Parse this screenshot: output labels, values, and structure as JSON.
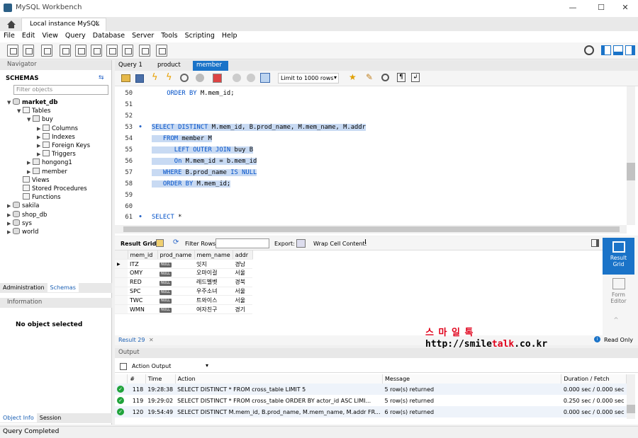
{
  "window": {
    "title": "MySQL Workbench",
    "connection_tab": "Local instance MySQL"
  },
  "menu": [
    "File",
    "Edit",
    "View",
    "Query",
    "Database",
    "Server",
    "Tools",
    "Scripting",
    "Help"
  ],
  "navigator": {
    "title": "Navigator",
    "schemas_label": "SCHEMAS",
    "filter_placeholder": "Filter objects",
    "tree": [
      {
        "label": "market_db",
        "level": 0,
        "open": true,
        "bold": true,
        "icon": "db"
      },
      {
        "label": "Tables",
        "level": 1,
        "open": true,
        "icon": "folder"
      },
      {
        "label": "buy",
        "level": 2,
        "open": true,
        "icon": "table"
      },
      {
        "label": "Columns",
        "level": 3,
        "open": false,
        "icon": "folder"
      },
      {
        "label": "Indexes",
        "level": 3,
        "open": false,
        "icon": "folder"
      },
      {
        "label": "Foreign Keys",
        "level": 3,
        "open": false,
        "icon": "folder"
      },
      {
        "label": "Triggers",
        "level": 3,
        "open": false,
        "icon": "folder"
      },
      {
        "label": "hongong1",
        "level": 2,
        "open": false,
        "icon": "table"
      },
      {
        "label": "member",
        "level": 2,
        "open": false,
        "icon": "table"
      },
      {
        "label": "Views",
        "level": 1,
        "icon": "folder"
      },
      {
        "label": "Stored Procedures",
        "level": 1,
        "icon": "folder"
      },
      {
        "label": "Functions",
        "level": 1,
        "icon": "folder"
      },
      {
        "label": "sakila",
        "level": 0,
        "open": false,
        "icon": "db"
      },
      {
        "label": "shop_db",
        "level": 0,
        "open": false,
        "icon": "db"
      },
      {
        "label": "sys",
        "level": 0,
        "open": false,
        "icon": "db"
      },
      {
        "label": "world",
        "level": 0,
        "open": false,
        "icon": "db"
      }
    ],
    "tabs": [
      "Administration",
      "Schemas"
    ],
    "info_title": "Information",
    "no_object": "No object selected",
    "bottom_tabs": [
      "Object Info",
      "Session"
    ]
  },
  "query_tabs": [
    "Query 1",
    "product",
    "member"
  ],
  "limit": "Limit to 1000 rows",
  "code_lines": [
    {
      "n": "50",
      "dot": false,
      "sel": false,
      "indent": "    ",
      "text": "ORDER BY M.mem_id;"
    },
    {
      "n": "51",
      "dot": false,
      "sel": false,
      "indent": "",
      "text": ""
    },
    {
      "n": "52",
      "dot": false,
      "sel": false,
      "indent": "",
      "text": ""
    },
    {
      "n": "53",
      "dot": true,
      "sel": true,
      "indent": "",
      "text": "SELECT DISTINCT M.mem_id, B.prod_name, M.mem_name, M.addr"
    },
    {
      "n": "54",
      "dot": false,
      "sel": true,
      "indent": "   ",
      "text": "FROM member M"
    },
    {
      "n": "55",
      "dot": false,
      "sel": true,
      "indent": "      ",
      "text": "LEFT OUTER JOIN buy B"
    },
    {
      "n": "56",
      "dot": false,
      "sel": true,
      "indent": "      ",
      "text": "On M.mem_id = b.mem_id"
    },
    {
      "n": "57",
      "dot": false,
      "sel": true,
      "indent": "   ",
      "text": "WHERE B.prod_name IS NULL"
    },
    {
      "n": "58",
      "dot": false,
      "sel": true,
      "indent": "   ",
      "text": "ORDER BY M.mem_id;"
    },
    {
      "n": "59",
      "dot": false,
      "sel": false,
      "indent": "",
      "text": ""
    },
    {
      "n": "60",
      "dot": false,
      "sel": false,
      "indent": "",
      "text": ""
    },
    {
      "n": "61",
      "dot": true,
      "sel": false,
      "indent": "",
      "text": "SELECT *"
    }
  ],
  "result": {
    "label": "Result Grid",
    "filter_label": "Filter Rows:",
    "export_label": "Export:",
    "wrap_label": "Wrap Cell Content:",
    "columns": [
      "mem_id",
      "prod_name",
      "mem_name",
      "addr"
    ],
    "rows": [
      [
        "ITZ",
        "NULL",
        "잇지",
        "경남"
      ],
      [
        "OMY",
        "NULL",
        "오마이걸",
        "서울"
      ],
      [
        "RED",
        "NULL",
        "레드벨벳",
        "경북"
      ],
      [
        "SPC",
        "NULL",
        "우주소녀",
        "서울"
      ],
      [
        "TWC",
        "NULL",
        "트와이스",
        "서울"
      ],
      [
        "WMN",
        "NULL",
        "여자친구",
        "경기"
      ]
    ],
    "side": [
      "Result Grid",
      "Form Editor"
    ],
    "tab": "Result 29",
    "read_only": "Read Only"
  },
  "output": {
    "title": "Output",
    "mode": "Action Output",
    "columns": [
      "#",
      "Time",
      "Action",
      "Message",
      "Duration / Fetch"
    ],
    "rows": [
      [
        "118",
        "19:28:38",
        "SELECT DISTINCT * FROM cross_table LIMIT 5",
        "5 row(s) returned",
        "0.000 sec / 0.000 sec"
      ],
      [
        "119",
        "19:29:02",
        "SELECT DISTINCT * FROM cross_table ORDER BY actor_id ASC LIMI...",
        "5 row(s) returned",
        "0.250 sec / 0.000 sec"
      ],
      [
        "120",
        "19:54:49",
        "SELECT DISTINCT M.mem_id, B.prod_name, M.mem_name, M.addr FR...",
        "6 row(s) returned",
        "0.000 sec / 0.000 sec"
      ]
    ]
  },
  "watermark": {
    "line1": "스 마 일 톡",
    "line2a": "http://smile",
    "line2b": "talk",
    "line2c": ".co.kr"
  },
  "status": "Query Completed",
  "colors": {
    "accent": "#1a73c8",
    "selection": "#c8daf3",
    "keyword": "#0050c8",
    "ok": "#1fa33a"
  }
}
